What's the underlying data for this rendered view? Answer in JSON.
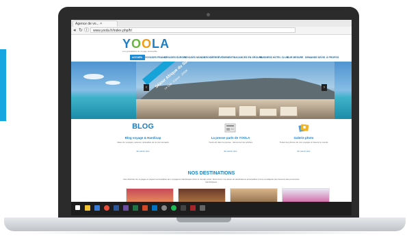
{
  "browser": {
    "tab_title": "Agence de vo... ×",
    "nav_back": "◂",
    "nav_reload": "↻",
    "nav_secure": "ⓘ",
    "url": "www.yoola.fr/index.php/fr/"
  },
  "site": {
    "logo_parts": [
      "Y",
      "O",
      "O",
      "L",
      "A"
    ],
    "logo_tagline": "Les spécialistes du voyage accessible",
    "menu": [
      {
        "label": "ACCUEIL",
        "active": true
      },
      {
        "label": "VOYAGES FRANCE",
        "active": false
      },
      {
        "label": "VOYAGES EUROPE",
        "active": false
      },
      {
        "label": "VOYAGES MONDE",
        "active": false
      },
      {
        "label": "CROISIÈRES",
        "active": false
      },
      {
        "label": "ÉVÉNEMENTS",
        "active": false
      },
      {
        "label": "VACANCES EN GROUPE",
        "active": false
      },
      {
        "label": "BUSINESS HOTEL CLUB",
        "active": false
      },
      {
        "label": "SUR MESURE",
        "active": false
      },
      {
        "label": "DEMANDE DEVIS",
        "active": false
      },
      {
        "label": "À PROPOS",
        "active": false
      }
    ]
  },
  "hero": {
    "sash_title": "Séjour Afrique du Sud",
    "sash_subtitle": "Le Cap · 9 jours · 2390€",
    "prev": "‹",
    "next": "›"
  },
  "features": [
    {
      "icon": "blog-icon",
      "title": "Blog voyage & Handicap",
      "desc": "Idées de voyages, astuces, actualités de la communauté",
      "link": "En savoir plus"
    },
    {
      "icon": "newspaper-icon",
      "title": "La presse parle de YOOLA",
      "desc": "Yoola est dans la presse : découvrez les articles",
      "link": "En savoir plus"
    },
    {
      "icon": "photo-gallery-icon",
      "title": "Galerie photo",
      "desc": "Toutes les photos de nos voyages à travers le monde",
      "link": "En savoir plus"
    }
  ],
  "feature_blog_logo": "BLOG",
  "destinations": {
    "title": "NOS DESTINATIONS",
    "desc": "Des dizaines de voyages et séjours accessibles aux voyageurs handicapés dans le monde entier. Découvrez nos idées de destinations accessibles à tous et adaptés aux besoins des personnes handicapées."
  },
  "colors": {
    "accent": "#16a6e0",
    "brand": "#1a7fc4",
    "bezel": "#2b2b2b",
    "taskbar": "#1d1d1d"
  },
  "taskbar_icons": [
    "windows-icon",
    "file-explorer-icon",
    "store-icon",
    "chrome-icon",
    "word-icon",
    "excel-icon",
    "powerpoint-icon",
    "outlook-icon",
    "settings-icon",
    "spotify-icon",
    "photoshop-icon",
    "app-icon"
  ]
}
